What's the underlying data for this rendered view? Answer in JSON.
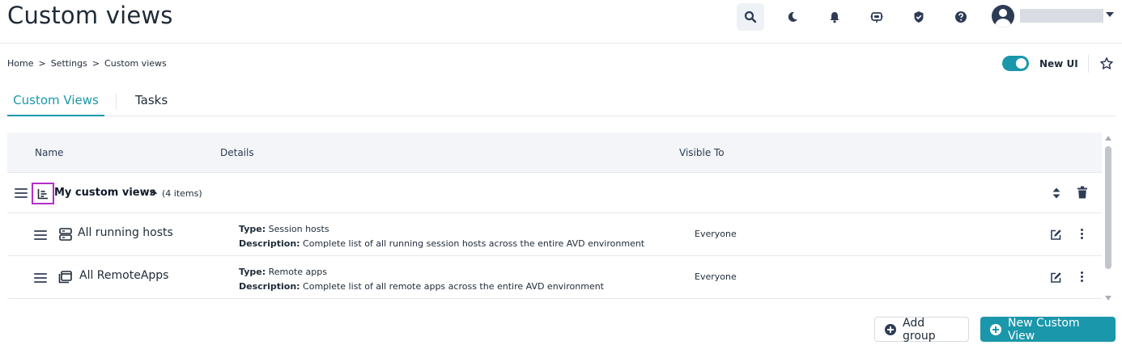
{
  "page": {
    "title": "Custom views"
  },
  "header": {
    "icons": [
      "search-icon",
      "moon-icon",
      "bell-icon",
      "chatbot-icon",
      "shield-check-icon",
      "help-icon"
    ],
    "user": {
      "avatar": "user-avatar-icon"
    }
  },
  "breadcrumb": {
    "items": [
      "Home",
      "Settings",
      "Custom views"
    ],
    "separator": ">"
  },
  "new_ui": {
    "label": "New UI",
    "enabled": true
  },
  "tabs": [
    {
      "label": "Custom Views",
      "active": true
    },
    {
      "label": "Tasks",
      "active": false
    }
  ],
  "table": {
    "columns": [
      "Name",
      "Details",
      "Visible To"
    ],
    "group": {
      "title": "My custom views",
      "count": "(4 items)",
      "expanded": true
    },
    "rows": [
      {
        "name": "All running hosts",
        "icon": "server-icon",
        "type_label": "Type:",
        "type": "Session hosts",
        "description_label": "Description:",
        "description": "Complete list of all running session hosts across the entire AVD environment",
        "visible_to": "Everyone"
      },
      {
        "name": "All RemoteApps",
        "icon": "windows-icon",
        "type_label": "Type:",
        "type": "Remote apps",
        "description_label": "Description:",
        "description": "Complete list of all remote apps across the entire AVD environment",
        "visible_to": "Everyone"
      }
    ]
  },
  "actions": {
    "add_group": "Add group",
    "new_custom_view": "New Custom View"
  },
  "colors": {
    "accent": "#1a97aa",
    "highlight": "#b12fc9",
    "dark": "#2d3b55"
  }
}
